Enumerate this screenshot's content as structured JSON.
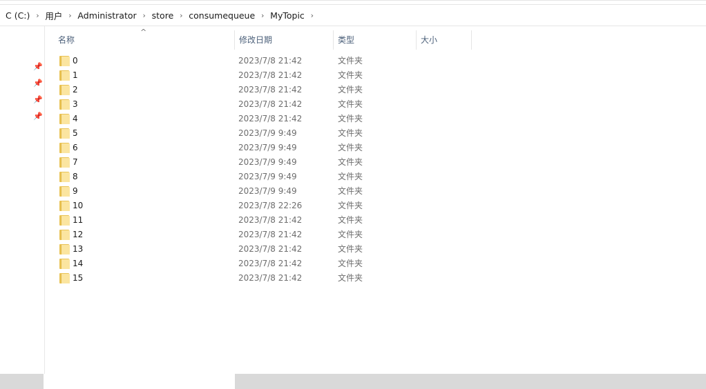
{
  "address_bar": {
    "crumbs": [
      "C (C:)",
      "用户",
      "Administrator",
      "store",
      "consumequeue",
      "MyTopic"
    ]
  },
  "columns": {
    "name": "名称",
    "date": "修改日期",
    "type": "类型",
    "size": "大小"
  },
  "files": [
    {
      "name": "0",
      "date": "2023/7/8 21:42",
      "type": "文件夹"
    },
    {
      "name": "1",
      "date": "2023/7/8 21:42",
      "type": "文件夹"
    },
    {
      "name": "2",
      "date": "2023/7/8 21:42",
      "type": "文件夹"
    },
    {
      "name": "3",
      "date": "2023/7/8 21:42",
      "type": "文件夹"
    },
    {
      "name": "4",
      "date": "2023/7/8 21:42",
      "type": "文件夹"
    },
    {
      "name": "5",
      "date": "2023/7/9 9:49",
      "type": "文件夹"
    },
    {
      "name": "6",
      "date": "2023/7/9 9:49",
      "type": "文件夹"
    },
    {
      "name": "7",
      "date": "2023/7/9 9:49",
      "type": "文件夹"
    },
    {
      "name": "8",
      "date": "2023/7/9 9:49",
      "type": "文件夹"
    },
    {
      "name": "9",
      "date": "2023/7/9 9:49",
      "type": "文件夹"
    },
    {
      "name": "10",
      "date": "2023/7/8 22:26",
      "type": "文件夹"
    },
    {
      "name": "11",
      "date": "2023/7/8 21:42",
      "type": "文件夹"
    },
    {
      "name": "12",
      "date": "2023/7/8 21:42",
      "type": "文件夹"
    },
    {
      "name": "13",
      "date": "2023/7/8 21:42",
      "type": "文件夹"
    },
    {
      "name": "14",
      "date": "2023/7/8 21:42",
      "type": "文件夹"
    },
    {
      "name": "15",
      "date": "2023/7/8 21:42",
      "type": "文件夹"
    }
  ],
  "icons": {
    "folder": "folder-icon",
    "pin": "pin-icon",
    "chevron": "chevron-right-icon",
    "sort": "sort-ascending-icon"
  },
  "colors": {
    "header_text": "#4c607a",
    "secondary_text": "#6d6d6d",
    "folder": "#fbe5a0"
  }
}
